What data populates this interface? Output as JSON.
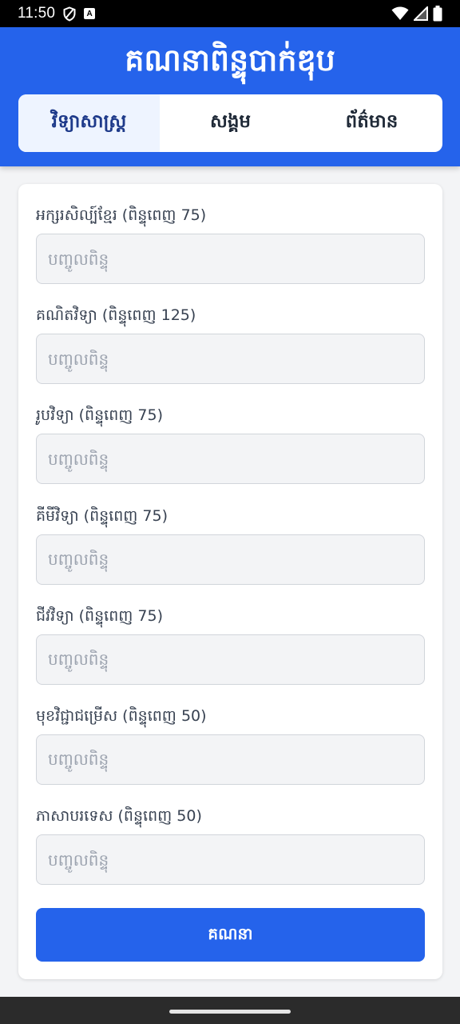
{
  "status_bar": {
    "time": "11:50",
    "badge_letter": "A",
    "icons": [
      "shield-icon",
      "a-badge-icon",
      "wifi-icon",
      "signal-icon",
      "battery-icon"
    ]
  },
  "app": {
    "title": "គណនាពិន្ទុបាក់ឌុប",
    "accent_color": "#2563eb"
  },
  "tabs": [
    {
      "label": "វិទ្យាសាស្ត្រ",
      "active": true
    },
    {
      "label": "សង្គម",
      "active": false
    },
    {
      "label": "ព័ត៌មាន",
      "active": false
    }
  ],
  "form": {
    "fields": [
      {
        "label": "អក្សរសិល្ប៍ខ្មែរ (ពិន្ទុពេញ 75)",
        "placeholder": "បញ្ចូលពិន្ទុ",
        "value": ""
      },
      {
        "label": "គណិតវិទ្យា (ពិន្ទុពេញ 125)",
        "placeholder": "បញ្ចូលពិន្ទុ",
        "value": ""
      },
      {
        "label": "រូបវិទ្យា (ពិន្ទុពេញ 75)",
        "placeholder": "បញ្ចូលពិន្ទុ",
        "value": ""
      },
      {
        "label": "គីមីវិទ្យា (ពិន្ទុពេញ 75)",
        "placeholder": "បញ្ចូលពិន្ទុ",
        "value": ""
      },
      {
        "label": "ជីវវិទ្យា (ពិន្ទុពេញ 75)",
        "placeholder": "បញ្ចូលពិន្ទុ",
        "value": ""
      },
      {
        "label": "មុខវិជ្ជាជម្រើស (ពិន្ទុពេញ 50)",
        "placeholder": "បញ្ចូលពិន្ទុ",
        "value": ""
      },
      {
        "label": "ភាសាបរទេស (ពិន្ទុពេញ 50)",
        "placeholder": "បញ្ចូលពិន្ទុ",
        "value": ""
      }
    ],
    "submit_label": "គណនា"
  }
}
